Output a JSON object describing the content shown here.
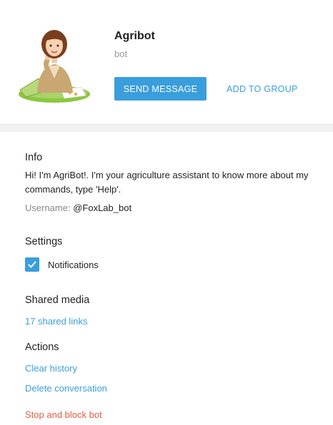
{
  "profile": {
    "name": "Agribot",
    "subtitle": "bot",
    "send_message_label": "SEND MESSAGE",
    "add_to_group_label": "ADD TO GROUP"
  },
  "info": {
    "title": "Info",
    "description": "Hi! I'm AgriBot!. I'm your agriculture assistant to know more about my commands, type 'Help'.",
    "username_label": "Username:",
    "username_value": "@FoxLab_bot"
  },
  "settings": {
    "title": "Settings",
    "notifications_label": "Notifications",
    "notifications_checked": true
  },
  "shared_media": {
    "title": "Shared media",
    "links_label": "17 shared links"
  },
  "actions": {
    "title": "Actions",
    "clear_history": "Clear history",
    "delete_conversation": "Delete conversation",
    "stop_and_block": "Stop and block bot"
  },
  "colors": {
    "accent": "#3a9edc",
    "danger": "#e05c45"
  }
}
